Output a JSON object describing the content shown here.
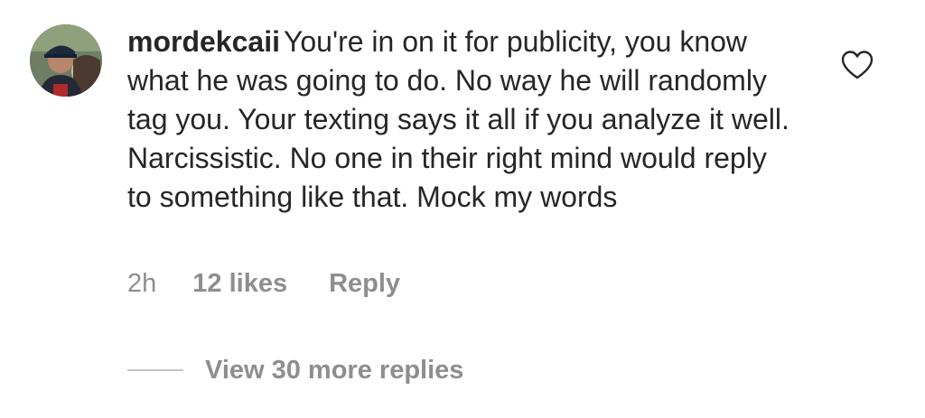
{
  "comment": {
    "username": "mordekcaii",
    "text": "You're in on it for publicity, you know what he was going to do. No way he will randomly tag you. Your texting says it all if you analyze it well. Narcissistic. No one in their right mind would reply to something like that. Mock my words",
    "time": "2h",
    "likes": "12 likes",
    "reply_label": "Reply",
    "like_icon": "heart-outline-icon"
  },
  "replies": {
    "view_more_label": "View 30 more replies"
  },
  "colors": {
    "text_primary": "#262626",
    "text_secondary": "#8e8e8e",
    "divider": "#c7c7c7"
  }
}
